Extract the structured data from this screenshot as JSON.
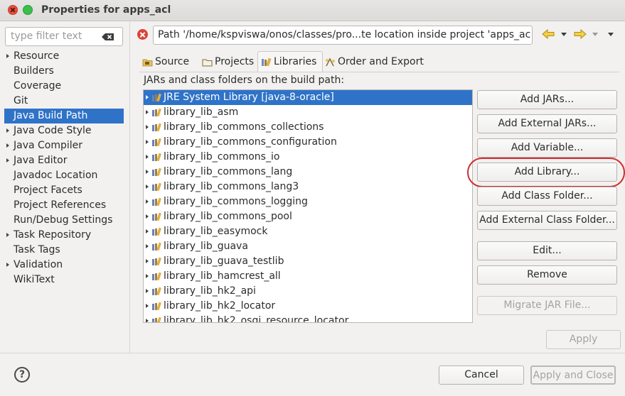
{
  "window": {
    "title": "Properties for apps_acl"
  },
  "filter": {
    "placeholder": "type filter text"
  },
  "sidebar": {
    "items": [
      {
        "label": "Resource",
        "expandable": true
      },
      {
        "label": "Builders",
        "expandable": false
      },
      {
        "label": "Coverage",
        "expandable": false
      },
      {
        "label": "Git",
        "expandable": false
      },
      {
        "label": "Java Build Path",
        "expandable": false,
        "selected": true
      },
      {
        "label": "Java Code Style",
        "expandable": true
      },
      {
        "label": "Java Compiler",
        "expandable": true
      },
      {
        "label": "Java Editor",
        "expandable": true
      },
      {
        "label": "Javadoc Location",
        "expandable": false
      },
      {
        "label": "Project Facets",
        "expandable": false
      },
      {
        "label": "Project References",
        "expandable": false
      },
      {
        "label": "Run/Debug Settings",
        "expandable": false
      },
      {
        "label": "Task Repository",
        "expandable": true
      },
      {
        "label": "Task Tags",
        "expandable": false
      },
      {
        "label": "Validation",
        "expandable": true
      },
      {
        "label": "WikiText",
        "expandable": false
      }
    ]
  },
  "message": {
    "text": "Path '/home/kspviswa/onos/classes/pro...te location inside project 'apps_ac"
  },
  "tabs": [
    {
      "label": "Source",
      "icon": "source-folder-icon"
    },
    {
      "label": "Projects",
      "icon": "projects-folder-icon"
    },
    {
      "label": "Libraries",
      "icon": "library-icon",
      "active": true
    },
    {
      "label": "Order and Export",
      "icon": "order-export-icon"
    }
  ],
  "libraries": {
    "heading": "JARs and class folders on the build path:",
    "items": [
      {
        "label": "JRE System Library [java-8-oracle]",
        "selected": true
      },
      {
        "label": "library_lib_asm"
      },
      {
        "label": "library_lib_commons_collections"
      },
      {
        "label": "library_lib_commons_configuration"
      },
      {
        "label": "library_lib_commons_io"
      },
      {
        "label": "library_lib_commons_lang"
      },
      {
        "label": "library_lib_commons_lang3"
      },
      {
        "label": "library_lib_commons_logging"
      },
      {
        "label": "library_lib_commons_pool"
      },
      {
        "label": "library_lib_easymock"
      },
      {
        "label": "library_lib_guava"
      },
      {
        "label": "library_lib_guava_testlib"
      },
      {
        "label": "library_lib_hamcrest_all"
      },
      {
        "label": "library_lib_hk2_api"
      },
      {
        "label": "library_lib_hk2_locator"
      },
      {
        "label": "library_lib_hk2_osgi_resource_locator"
      }
    ]
  },
  "buttons": {
    "add_jars": "Add JARs...",
    "add_external_jars": "Add External JARs...",
    "add_variable": "Add Variable...",
    "add_library": "Add Library...",
    "add_class_folder": "Add Class Folder...",
    "add_external_class_folder": "Add External Class Folder...",
    "edit": "Edit...",
    "remove": "Remove",
    "migrate_jar": "Migrate JAR File...",
    "apply": "Apply",
    "cancel": "Cancel",
    "apply_and_close": "Apply and Close"
  },
  "colors": {
    "selection": "#2f73c8",
    "highlight_ring": "#cf3030",
    "error": "#d9433a"
  }
}
